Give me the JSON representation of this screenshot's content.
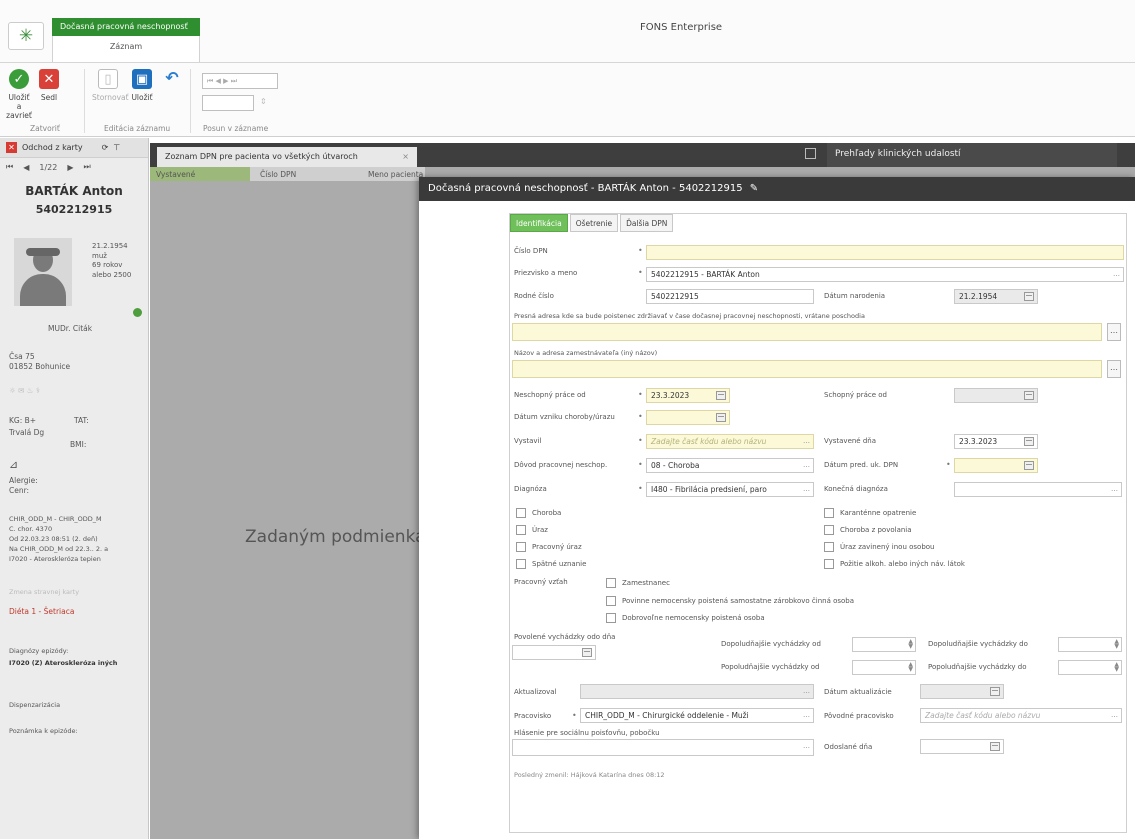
{
  "app": {
    "title": "FONS Enterprise"
  },
  "ribbon": {
    "context_tab_group": "Dočasná pracovná neschopnosť",
    "context_tab": "Záznam",
    "buttons": {
      "save_close": "Uložiť a zavrieť",
      "close": "Sedl",
      "cancel": "Stornovať",
      "save": "Uložiť",
      "undo": ""
    },
    "groups": {
      "close": "Zatvoriť",
      "record_editing": "Editácia záznamu",
      "record_moves": "Posun v zázname"
    }
  },
  "patient_panel": {
    "exit_label": "Odchod z karty",
    "pager": "1/22",
    "name": "BARTÁK Anton",
    "id": "5402212915",
    "birth_date": "21.2.1954",
    "sex": "muž",
    "age": "69 rokov",
    "extra": "alebo 2500",
    "doctor": "MUDr. Citák",
    "address_line1": "Čsa 75",
    "address_line2": "01852 Bohunice",
    "kg_label": "KG: B+",
    "kg_value": "TAT:",
    "insurance_label": "Trvalá Dg",
    "insurance_value": "BMI:",
    "allergy": "Alergie:",
    "diet": "Cenr:",
    "ward_line1": "CHIR_ODD_M - CHIR_ODD_M",
    "ward_line2": "C. chor. 4370",
    "ward_line3": "Od 22.03.23 08:51 (2. deň)",
    "ward_line4": "Na CHIR_ODD_M od 22.3.. 2. a",
    "ward_line5": "I7020 - Ateroskleróza tepien",
    "hospitalization_link": "Zmena stravnej karty",
    "diet_status": "Diéta 1 - Šetriaca",
    "diagnoses_label": "Diagnózy epizódy:",
    "diagnosis_main": "I7020 (Z) Ateroskleróza iných",
    "dispensarization": "Dispenzarizácia",
    "note": "Poznámka k epizóde:"
  },
  "doc_tabs": {
    "tab1": "Zoznam DPN pre pacienta vo všetkých útvaroch",
    "tab1_close": "×",
    "tab2": "Prehľady klinických udalostí"
  },
  "grid": {
    "col_issued": "Vystavené",
    "col_number": "Číslo DPN",
    "col_name": "Meno pacienta",
    "empty_message": "Zadaným podmienkam"
  },
  "dialog": {
    "title": "Dočasná pracovná neschopnosť - BARTÁK Anton - 5402212915",
    "tabs": [
      "Identifikácia",
      "Ošetrenie",
      "Ďalšia DPN"
    ],
    "labels": {
      "dpn_number": "Číslo DPN",
      "surname_name": "Priezvisko a meno",
      "birth_number": "Rodné číslo",
      "birth_date": "Dátum narodenia",
      "address": "Presná adresa kde sa bude poistenec zdržiavať v čase dočasnej pracovnej neschopnosti, vrátane poschodia",
      "employer": "Názov a adresa zamestnávateľa (iný názov)",
      "unable_from": "Neschopný práce od",
      "able_from": "Schopný práce od",
      "illness_date": "Dátum vzniku choroby/úrazu",
      "issued_by": "Vystavil",
      "issued_on": "Vystavené dňa",
      "reason": "Dôvod pracovnej neschop.",
      "pred_date": "Dátum pred. uk. DPN",
      "diagnosis": "Diagnóza",
      "final_diagnosis": "Konečná diagnóza",
      "work_relation": "Pracovný vzťah",
      "permitted_walks": "Povolené vychádzky odo dňa",
      "morning_from": "Dopoludňajšie vychádzky od",
      "morning_to": "Dopoludňajšie vychádzky do",
      "afternoon_from": "Popoludňajšie vychádzky od",
      "afternoon_to": "Popoludňajšie vychádzky do",
      "updated_by": "Aktualizoval",
      "update_date": "Dátum aktualizácie",
      "workplace": "Pracovisko",
      "original_workplace": "Pôvodné pracovisko",
      "report_branch": "Hlásenie pre sociálnu poisťovňu, pobočku",
      "sent_date": "Odoslané dňa"
    },
    "values": {
      "dpn_number": "",
      "surname_name": "5402212915 - BARTÁK Anton",
      "birth_number": "5402212915",
      "birth_date": "21.2.1954",
      "unable_from": "23.3.2023",
      "issued_by_placeholder": "Zadajte časť kódu alebo názvu",
      "issued_on": "23.3.2023",
      "reason": "08 - Choroba",
      "diagnosis": "I480 - Fibrilácia predsiení, paro",
      "workplace": "CHIR_ODD_M - Chirurgické oddelenie - Muži",
      "original_workplace_placeholder": "Zadajte časť kódu alebo názvu"
    },
    "checkboxes_left": [
      "Choroba",
      "Úraz",
      "Pracovný úraz",
      "Spätné uznanie"
    ],
    "checkboxes_right": [
      "Karanténne opatrenie",
      "Choroba z povolania",
      "Úraz zavinený inou osobou",
      "Požitie alkoh. alebo iných náv. látok"
    ],
    "work_relation_options": [
      "Zamestnanec",
      "Povinne nemocensky poistená samostatne zárobkovo činná osoba",
      "Dobrovoľne nemocensky poistená osoba"
    ],
    "audit": "Posledný zmenil: Hájková Katarína  dnes 08:12"
  }
}
